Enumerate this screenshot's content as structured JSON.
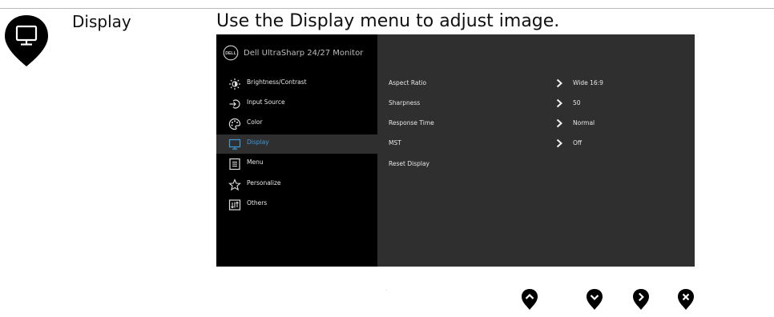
{
  "section": {
    "label": "Display",
    "icon": "monitor-pin-icon",
    "description": "Use the Display menu to adjust image."
  },
  "osd": {
    "header": {
      "logo": "DELL",
      "title": "Dell UltraSharp 24/27 Monitor"
    },
    "menu": [
      {
        "label": "Brightness/Contrast",
        "icon": "brightness-icon",
        "selected": false
      },
      {
        "label": "Input Source",
        "icon": "input-source-icon",
        "selected": false
      },
      {
        "label": "Color",
        "icon": "color-palette-icon",
        "selected": false
      },
      {
        "label": "Display",
        "icon": "display-icon",
        "selected": true
      },
      {
        "label": "Menu",
        "icon": "menu-icon",
        "selected": false
      },
      {
        "label": "Personalize",
        "icon": "star-icon",
        "selected": false
      },
      {
        "label": "Others",
        "icon": "others-icon",
        "selected": false
      }
    ],
    "submenu": [
      {
        "label": "Aspect Ratio",
        "value": "Wide 16:9",
        "has_arrow": true
      },
      {
        "label": "Sharpness",
        "value": "50",
        "has_arrow": true
      },
      {
        "label": "Response Time",
        "value": "Normal",
        "has_arrow": true
      },
      {
        "label": "MST",
        "value": "Off",
        "has_arrow": true
      },
      {
        "label": "Reset Display",
        "value": "",
        "has_arrow": false
      }
    ]
  },
  "nav_buttons": [
    {
      "name": "up-button",
      "icon": "chevron-up-icon"
    },
    {
      "name": "down-button",
      "icon": "chevron-down-icon"
    },
    {
      "name": "right-button",
      "icon": "chevron-right-icon"
    },
    {
      "name": "exit-button",
      "icon": "close-icon"
    }
  ],
  "colors": {
    "menu_bg": "#000000",
    "panel_bg": "#2f2f2f",
    "accent": "#3d9ad8",
    "text": "#e8e8e8"
  }
}
